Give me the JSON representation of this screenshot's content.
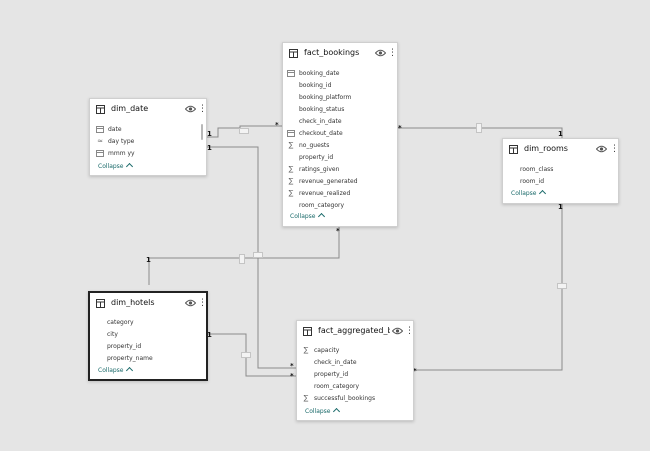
{
  "tables": {
    "fact_bookings": {
      "title": "fact_bookings",
      "fields": [
        {
          "name": "booking_date",
          "icon": "calendar-icon"
        },
        {
          "name": "booking_id",
          "icon": ""
        },
        {
          "name": "booking_platform",
          "icon": ""
        },
        {
          "name": "booking_status",
          "icon": ""
        },
        {
          "name": "check_in_date",
          "icon": ""
        },
        {
          "name": "checkout_date",
          "icon": "calendar-icon"
        },
        {
          "name": "no_guests",
          "icon": "sigma-icon"
        },
        {
          "name": "property_id",
          "icon": ""
        },
        {
          "name": "ratings_given",
          "icon": "sigma-icon"
        },
        {
          "name": "revenue_generated",
          "icon": "sigma-icon"
        },
        {
          "name": "revenue_realized",
          "icon": "sigma-icon"
        },
        {
          "name": "room_category",
          "icon": ""
        }
      ],
      "collapse": "Collapse"
    },
    "dim_date": {
      "title": "dim_date",
      "fields": [
        {
          "name": "date",
          "icon": "calendar-icon"
        },
        {
          "name": "day type",
          "icon": "calculated-icon"
        },
        {
          "name": "mmm yy",
          "icon": "calendar-icon"
        }
      ],
      "collapse": "Collapse"
    },
    "dim_rooms": {
      "title": "dim_rooms",
      "fields": [
        {
          "name": "room_class",
          "icon": ""
        },
        {
          "name": "room_id",
          "icon": ""
        }
      ],
      "collapse": "Collapse"
    },
    "dim_hotels": {
      "title": "dim_hotels",
      "fields": [
        {
          "name": "category",
          "icon": ""
        },
        {
          "name": "city",
          "icon": ""
        },
        {
          "name": "property_id",
          "icon": ""
        },
        {
          "name": "property_name",
          "icon": ""
        }
      ],
      "collapse": "Collapse"
    },
    "fact_aggregated": {
      "title": "fact_aggregated_boo...",
      "fields": [
        {
          "name": "capacity",
          "icon": "sigma-icon"
        },
        {
          "name": "check_in_date",
          "icon": ""
        },
        {
          "name": "property_id",
          "icon": ""
        },
        {
          "name": "room_category",
          "icon": ""
        },
        {
          "name": "successful_bookings",
          "icon": "sigma-icon"
        }
      ],
      "collapse": "Collapse"
    }
  },
  "cardinality": {
    "one": "1",
    "many": "*"
  },
  "colors": {
    "canvas": "#e5e5e5",
    "card": "#ffffff",
    "line": "#8a8a8a",
    "collapse": "#1a6a6a"
  }
}
